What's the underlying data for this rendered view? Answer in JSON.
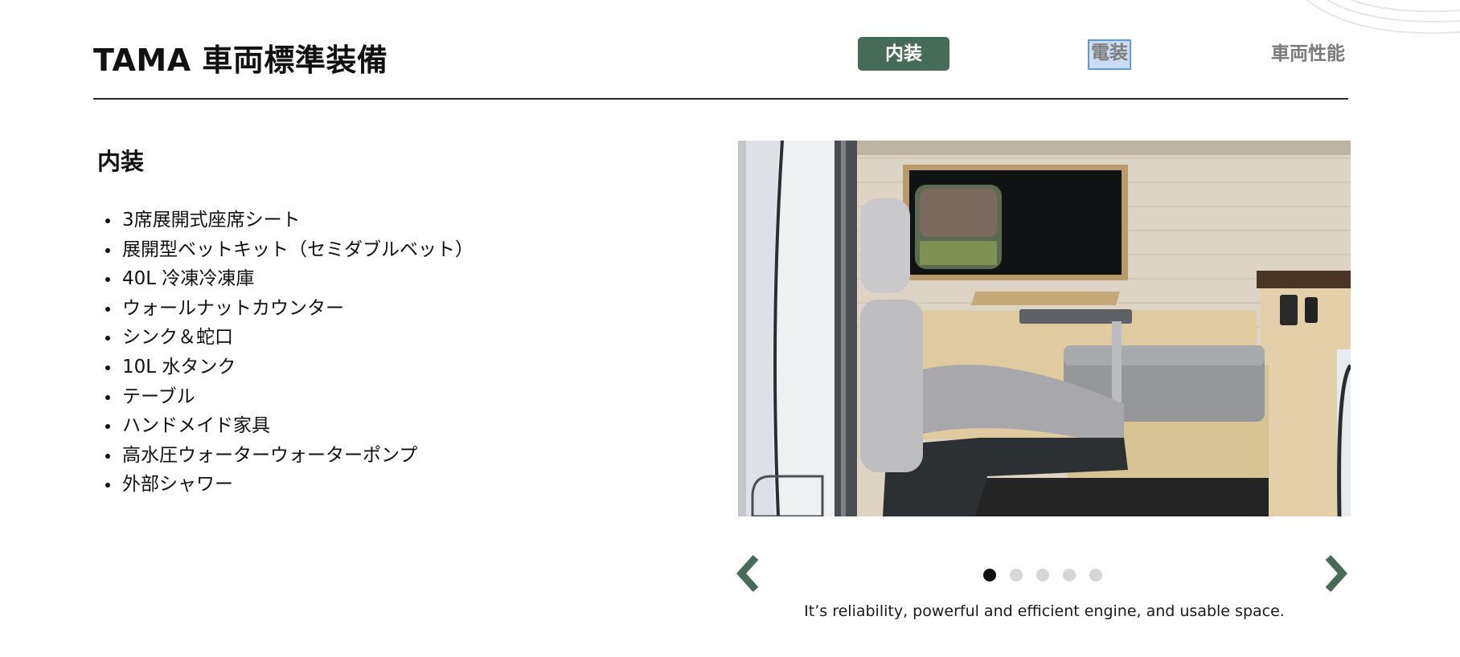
{
  "header": {
    "title": "TAMA 車両標準装備",
    "tabs": [
      {
        "label": "内装",
        "state": "active"
      },
      {
        "label": "電装",
        "state": "focused"
      },
      {
        "label": "車両性能",
        "state": "default"
      }
    ]
  },
  "section": {
    "heading": "内装",
    "items": [
      "3席展開式座席シート",
      "展開型ベットキット（セミダブルベット）",
      "40L 冷凍冷凍庫",
      "ウォールナットカウンター",
      "シンク＆蛇口",
      "10L 水タンク",
      "テーブル",
      "ハンドメイド家具",
      "高水圧ウォーターウォーターポンプ",
      "外部シャワー"
    ]
  },
  "carousel": {
    "slide_count": 5,
    "active_slide": 1,
    "caption": "It’s reliability, powerful and efficient engine, and usable space.",
    "prev_icon": "chevron-left-icon",
    "next_icon": "chevron-right-icon"
  },
  "colors": {
    "accent": "#466b58",
    "dot_active": "#111111",
    "dot_inactive": "#d6d6d6",
    "focus_outline": "#5b9be0"
  }
}
